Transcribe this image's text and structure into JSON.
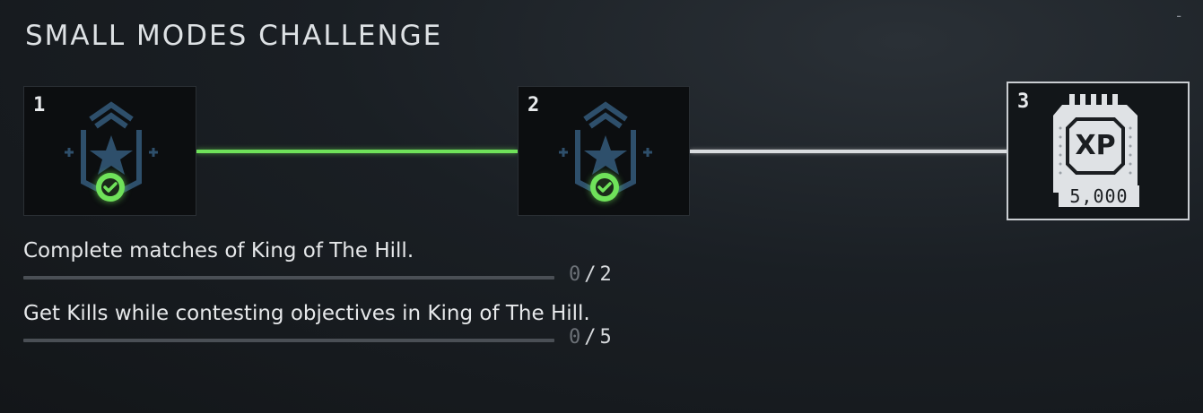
{
  "header": {
    "title": "SMALL MODES CHALLENGE",
    "minimize_label": "-"
  },
  "tiers": [
    {
      "number": "1",
      "icon": "challenge-badge-icon",
      "status": "completed",
      "status_icon": "checkmark-icon"
    },
    {
      "number": "2",
      "icon": "challenge-badge-icon",
      "status": "completed",
      "status_icon": "checkmark-icon"
    },
    {
      "number": "3",
      "icon": "xp-chip-icon",
      "xp_label": "XP",
      "reward": "5,000"
    }
  ],
  "connectors": [
    {
      "from": "1",
      "to": "2",
      "color": "#6fe25a"
    },
    {
      "from": "2",
      "to": "3",
      "color": "#d9dcdf"
    }
  ],
  "objectives": [
    {
      "text": "Complete matches of King of The Hill.",
      "current": "0",
      "separator": "/",
      "total": "2",
      "progress": 0
    },
    {
      "text": "Get Kills while contesting objectives in King of The Hill.",
      "current": "0",
      "separator": "/",
      "total": "5",
      "progress": 0
    }
  ],
  "colors": {
    "complete_green": "#6fe25a",
    "badge_blue": "#2e4f6b",
    "panel_bg": "#0c0e10"
  }
}
